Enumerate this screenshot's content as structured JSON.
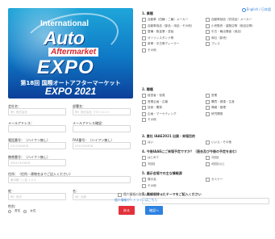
{
  "banner": {
    "line1": "International",
    "line2": "Auto",
    "line3": "Aftermarket",
    "line4": "EXPO",
    "line5": "第18回 国際オートアフターマーケット",
    "line6": "EXPO 2021"
  },
  "language": {
    "label": "English / 日本語"
  },
  "form": {
    "company": {
      "label": "会社名：",
      "placeholder": "例）株式会社"
    },
    "department": {
      "label": "部署名：",
      "placeholder": "例）株式会社 マネジメント"
    },
    "email": {
      "label": "メールアドレス：",
      "placeholder": ""
    },
    "email_confirm": {
      "label": "メールアドレス確認：",
      "placeholder": ""
    },
    "phone": {
      "label": "電話番号：（ハイフン無し）",
      "placeholder": "0312345678"
    },
    "fax": {
      "label": "FAX番号：（ハイフン無し）",
      "placeholder": "0312345678"
    },
    "mobile": {
      "label": "携帯番号：（ハイフン無し）",
      "placeholder": "09012345678"
    },
    "address": {
      "label": "住所：（住所・建物名までご記入ください）",
      "placeholder": "東京都 ○○区 1-2-3"
    },
    "lastname": {
      "label": "姓：",
      "placeholder": "例）田中"
    },
    "firstname": {
      "label": "名：",
      "placeholder": "例）太郎"
    },
    "gender": {
      "label": "性別：",
      "options": [
        "男性",
        "女性"
      ]
    }
  },
  "questions": [
    {
      "title": "1. 業種",
      "options": [
        "自動車（四輪・二輪）メーカー",
        "自動車部品（完成品）メーカー",
        "自動車用品（部品・用品・その他）",
        "小売販売・量販店等（用品店等）",
        "整備・鈑金業・塗装",
        "中古・輸出業者（用品）",
        "ガソリンスタンド等",
        "商社（卸売）",
        "新車・中古車ディーラー",
        "プレス",
        "その他"
      ]
    },
    {
      "title": "2. 職種",
      "options": [
        "経営者・役員",
        "営業",
        "営業企画・広報",
        "購買・調達・生産",
        "技術・開発",
        "情報・管理",
        "企画・マーケティング",
        "研究開発",
        "その他"
      ]
    },
    {
      "title": "3. 貴社 IAAE2021 出展・来場目的",
      "options": [
        "はい",
        "いいえ・その他"
      ]
    },
    {
      "title": "4. 今後IAAEにご来場予定ですか？（過去及び今後の予定を含む）",
      "options": [
        "はじめて",
        "2回目",
        "3回目",
        "4回目以上"
      ]
    },
    {
      "title": "5. 展示会場での主な情報源",
      "options": [
        "展示会",
        "セミナー",
        "その他"
      ]
    },
    {
      "title": "7. 興味を持ったテーマをご記入ください",
      "options": []
    }
  ],
  "bottom": {
    "checkbox_label": "個人情報の取扱いに同意する",
    "link_text": "個人情報ガイドラインはこちら",
    "back_label": "戻る",
    "next_label": "確認へ"
  }
}
